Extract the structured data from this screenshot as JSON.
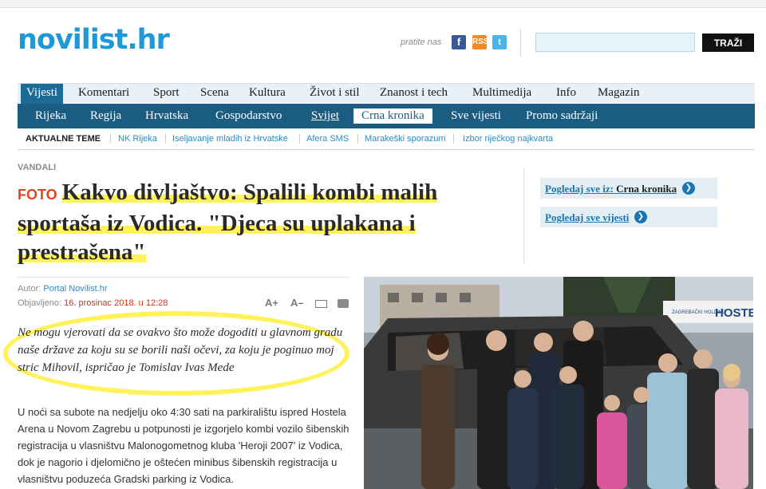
{
  "site": {
    "logo": "novilist.hr",
    "follow_label": "pratite nas",
    "search_button": "TRAŽI",
    "search_placeholder": ""
  },
  "social": {
    "facebook": "f",
    "rss": "RSS",
    "twitter": "t"
  },
  "nav_main": [
    "Vijesti",
    "Komentari",
    "Sport",
    "Scena",
    "Kultura",
    "Život i stil",
    "Znanost i tech",
    "Multimedija",
    "Info",
    "Magazin"
  ],
  "nav_sub": [
    "Rijeka",
    "Regija",
    "Hrvatska",
    "Gospodarstvo",
    "Svijet",
    "Crna kronika",
    "Sve vijesti",
    "Promo sadržaji"
  ],
  "nav_topics": {
    "label": "AKTUALNE TEME",
    "items": [
      "NK Rijeka",
      "Iseljavanje mladih iz Hrvatske",
      "Afera SMS",
      "Marakeški sporazum",
      "Izbor riječkog najkvarta"
    ]
  },
  "article": {
    "category": "VANDALI",
    "badge": "FOTO",
    "title": "Kakvo divljaštvo: Spalili kombi malih sportaša iz Vodica. \"Djeca su uplakana i prestrašena\"",
    "author_label": "Autor:",
    "author": "Portal Novilist.hr",
    "published_label": "Objavljeno:",
    "published": "16. prosinac 2018. u 12:28",
    "font_plus": "A+",
    "font_minus": "A–",
    "lead": "Ne mogu vjerovati da se ovakvo što može dogoditi u glavnom gradu naše države za koju su se borili naši očevi, za koju je poginuo moj stric Mihovil, ispričao je Tomislav Ivas Mede",
    "body": "U noći sa subote na nedjelju oko 4:30 sati na parkiralištu ispred Hostela Arena u Novom Zagrebu u potpunosti je izgorjelo kombi vozilo šibenskih registracija u vlasništvu Malonogometnog kluba 'Heroji 2007' iz Vodica, dok je nagorio i djelomično je oštećen minibus šibenskih registracija u vlasništvu poduzeća Gradski parking iz Vodica."
  },
  "sidebar": {
    "box1_label": "Pogledaj sve iz:",
    "box1_section": "Crna kronika",
    "box2_label": "Pogledaj sve vijesti"
  },
  "photo": {
    "hostel_sign": "HOSTE",
    "holding_label": "ZAGREBAČKI HOLDING"
  },
  "colors": {
    "brand": "#1d9ad6",
    "nav_dark": "#1a5c82",
    "nav_active": "#1c6a96",
    "highlight": "#fff25a",
    "foto_badge": "#e0451f"
  }
}
